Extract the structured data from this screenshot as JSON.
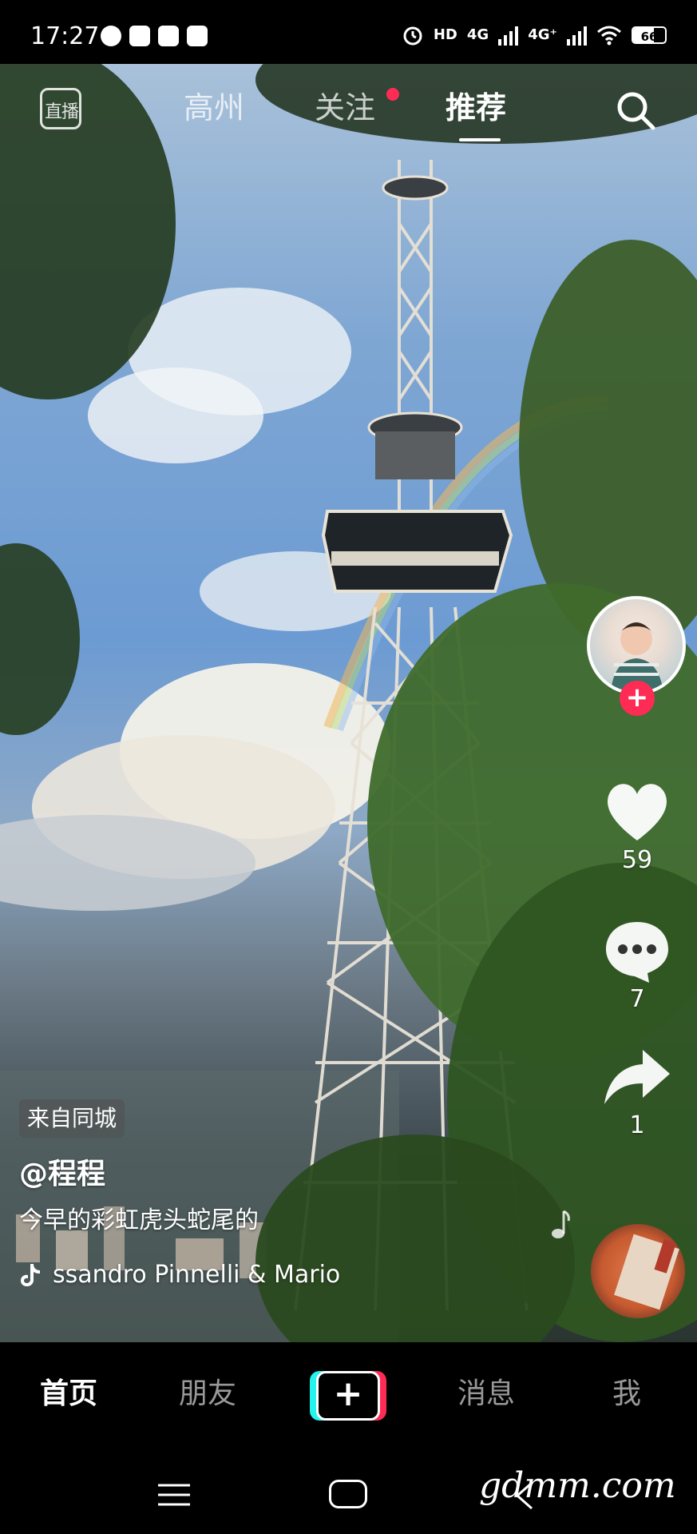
{
  "status_bar": {
    "time": "17:27",
    "app_icons": [
      "music-app-icon",
      "capcut-icon",
      "gmail-icon",
      "maps-icon"
    ],
    "alarm_icon": "alarm-icon",
    "hd_label": "HD",
    "network_1": "4G",
    "network_2": "4G⁺",
    "wifi_icon": "wifi-icon",
    "battery_level": "66",
    "battery_fraction": 0.66
  },
  "top_nav": {
    "live_label": "直播",
    "tabs": [
      {
        "label": "高州",
        "active": false
      },
      {
        "label": "关注",
        "active": false,
        "has_dot": true
      },
      {
        "label": "推荐",
        "active": true
      }
    ],
    "search_icon": "search-icon"
  },
  "right_rail": {
    "avatar_icon": "author-avatar",
    "follow_label": "+",
    "like_count": "59",
    "comment_count": "7",
    "share_count": "1"
  },
  "caption": {
    "tag": "来自同城",
    "author": "@程程",
    "description": "今早的彩虹虎头蛇尾的",
    "music": "ssandro Pinnelli & Mario"
  },
  "tab_bar": {
    "tabs": [
      {
        "label": "首页",
        "active": true
      },
      {
        "label": "朋友",
        "active": false
      },
      {
        "label": "消息",
        "active": false
      },
      {
        "label": "我",
        "active": false
      }
    ],
    "create_label": "+"
  },
  "watermark": "gdmm.com",
  "colors": {
    "accent_red": "#fe2c55",
    "accent_cyan": "#25f4ee"
  }
}
